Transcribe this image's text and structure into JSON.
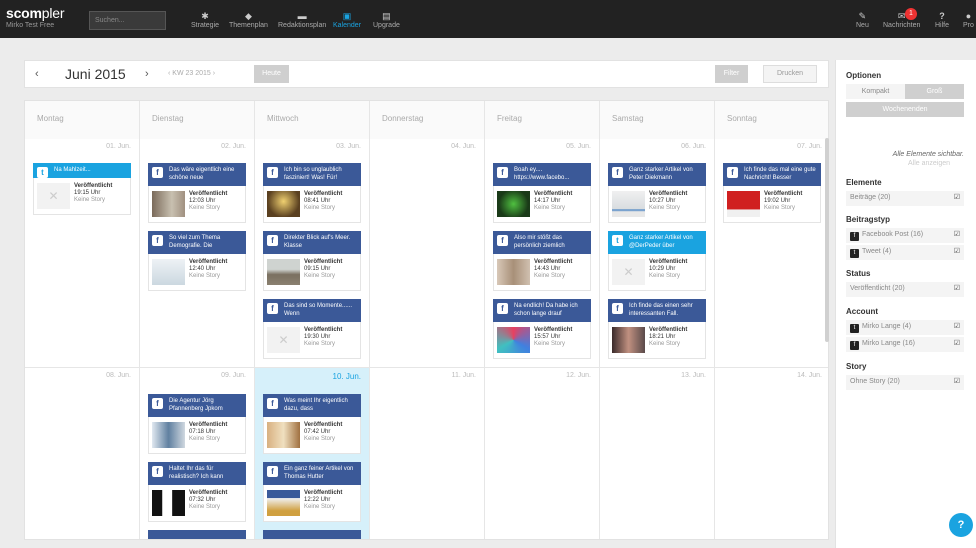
{
  "brand": {
    "logo_a": "scom",
    "logo_b": "pler",
    "org": "Mirko Test Free"
  },
  "search": {
    "placeholder": "Suchen..."
  },
  "nav": [
    {
      "label": "Strategie",
      "icon": "gear-icon"
    },
    {
      "label": "Themenplan",
      "icon": "tag-icon"
    },
    {
      "label": "Redaktionsplan",
      "icon": "folder-icon"
    },
    {
      "label": "Kalender",
      "icon": "calendar-icon"
    },
    {
      "label": "Upgrade",
      "icon": "upgrade-icon"
    }
  ],
  "right_nav": [
    {
      "label": "Neu",
      "icon": "pencil-icon"
    },
    {
      "label": "Nachrichten",
      "icon": "mail-icon",
      "badge": "1"
    },
    {
      "label": "Hilfe",
      "icon": "question-icon"
    },
    {
      "label": "Pro",
      "icon": "user-icon"
    }
  ],
  "toolbar": {
    "prev": "‹",
    "month": "Juni 2015",
    "next": "›",
    "week": "‹ KW 23 2015 ›",
    "heute": "Heute",
    "filter": "Filter",
    "drucken": "Drucken"
  },
  "days": [
    "Montag",
    "Dienstag",
    "Mittwoch",
    "Donnerstag",
    "Freitag",
    "Samstag",
    "Sonntag"
  ],
  "week1_dates": [
    "01. Jun.",
    "02. Jun.",
    "03. Jun.",
    "04. Jun.",
    "05. Jun.",
    "06. Jun.",
    "07. Jun."
  ],
  "week2_dates": [
    "08. Jun.",
    "09. Jun.",
    "10. Jun.",
    "11. Jun.",
    "12. Jun.",
    "13. Jun.",
    "14. Jun."
  ],
  "status_label": "Veröffentlicht",
  "story_label": "Keine Story",
  "posts": {
    "mo1": {
      "title": "Na Mahlzeit...",
      "time": "19:15 Uhr"
    },
    "di1": {
      "title": "Das wäre eigentlich eine schöne neue",
      "time": "12:03 Uhr"
    },
    "di2": {
      "title": "So viel zum Thema Demografie. Die",
      "time": "12:40 Uhr"
    },
    "mi1": {
      "title": "Ich bin so unglaublich fasziniert! Was! Für!",
      "time": "08:41 Uhr"
    },
    "mi2": {
      "title": "Direkter Blick auf's Meer. Klasse",
      "time": "09:15 Uhr"
    },
    "mi3": {
      "title": "Das sind so Momente...... Wenn",
      "time": "19:30 Uhr"
    },
    "fr1": {
      "title": "Boah ey.... https://www.facebo...",
      "time": "14:17 Uhr"
    },
    "fr2": {
      "title": "Also mir stößt das persönlich ziemlich",
      "time": "14:43 Uhr"
    },
    "fr3": {
      "title": "Na endlich! Da habe ich schon lange drauf",
      "time": "15:57 Uhr"
    },
    "sa1": {
      "title": "Ganz starker Artikel von Peter Diekmann",
      "time": "10:27 Uhr"
    },
    "sa2": {
      "title": "Ganz starker Artikel von @DerPeder über",
      "time": "10:29 Uhr"
    },
    "sa3": {
      "title": "Ich finde das einen sehr interessanten Fall.",
      "time": "18:21 Uhr"
    },
    "so1": {
      "title": "Ich finde das mal eine gute Nachricht! Besser",
      "time": "19:02 Uhr"
    },
    "di3": {
      "title": "Die Agentur Jörg Pfannenberg Jpkom",
      "time": "07:18 Uhr"
    },
    "di4": {
      "title": "Haltet Ihr das für realistisch? Ich kann",
      "time": "07:32 Uhr"
    },
    "mi4": {
      "title": "Was meint Ihr eigentlich dazu, dass",
      "time": "07:42 Uhr"
    },
    "mi5": {
      "title": "Ein ganz feiner Artikel von Thomas Hutter",
      "time": "12:22 Uhr"
    }
  },
  "sidebar": {
    "optionen": "Optionen",
    "kompakt": "Kompakt",
    "gross": "Groß",
    "wochenenden": "Wochenenden",
    "info": "Alle Elemente sichtbar.",
    "info2": "Alle anzeigen",
    "elemente": "Elemente",
    "beitraege": "Beiträge (20)",
    "beitragstyp": "Beitragstyp",
    "fbpost": "Facebook Post (16)",
    "tweet": "Tweet (4)",
    "status": "Status",
    "veroeff": "Veröffentlicht (20)",
    "account": "Account",
    "acc1": "Mirko Lange (4)",
    "acc2": "Mirko Lange (16)",
    "story": "Story",
    "ohne": "Ohne Story (20)"
  },
  "colors": {
    "facebook": "#3b5998",
    "twitter": "#1aa3e0",
    "today": "#d6f0fa",
    "topbar": "#222222"
  }
}
